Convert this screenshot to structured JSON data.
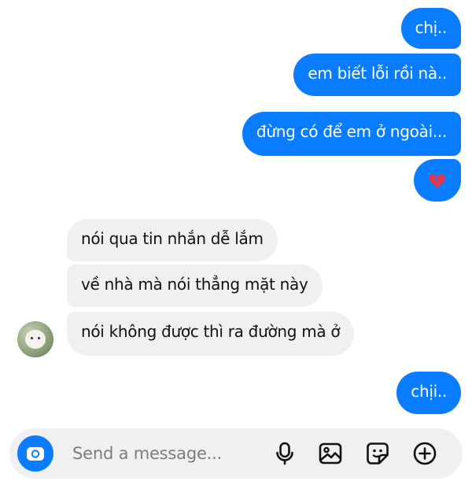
{
  "messages": {
    "outgoing_1": "chị..",
    "outgoing_2": "em biết lỗi rồi nà..",
    "outgoing_3": "đừng có để em ở ngoài...",
    "incoming_1": "nói qua tin nhắn dễ lắm",
    "incoming_2": "về nhà mà nói thẳng mặt này",
    "incoming_3": "nói không được thì ra đường mà ở",
    "outgoing_4": "chịi.."
  },
  "composer": {
    "placeholder": "Send a message..."
  },
  "icons": {
    "reaction": "broken-heart-icon",
    "camera": "camera-icon",
    "mic": "microphone-icon",
    "gallery": "image-icon",
    "sticker": "sticker-icon",
    "more": "plus-circle-icon"
  },
  "colors": {
    "outgoing_bubble": "#0a7cff",
    "incoming_bubble": "#f0f0f2",
    "broken_heart": "#e8344a"
  }
}
